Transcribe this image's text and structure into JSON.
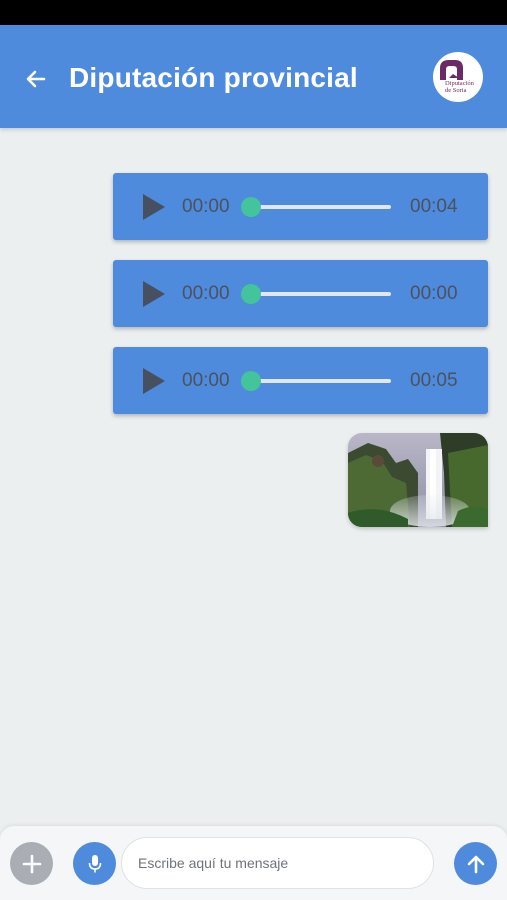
{
  "header": {
    "title": "Diputación provincial",
    "avatar_text": "Diputación\nde Soria"
  },
  "messages": {
    "audio": [
      {
        "current": "00:00",
        "duration": "00:04",
        "progress": 0
      },
      {
        "current": "00:00",
        "duration": "00:00",
        "progress": 0
      },
      {
        "current": "00:00",
        "duration": "00:05",
        "progress": 0
      }
    ],
    "image": {
      "alt": "waterfall photo"
    }
  },
  "composer": {
    "placeholder": "Escribe aquí tu mensaje"
  },
  "icons": {
    "back": "arrow-left-icon",
    "add": "plus-icon",
    "mic": "microphone-icon",
    "send": "arrow-up-icon",
    "play": "play-icon"
  },
  "colors": {
    "primary": "#4f8bdd",
    "accent": "#43c49a",
    "background": "#eceff0",
    "add_button": "#a9adb4"
  }
}
